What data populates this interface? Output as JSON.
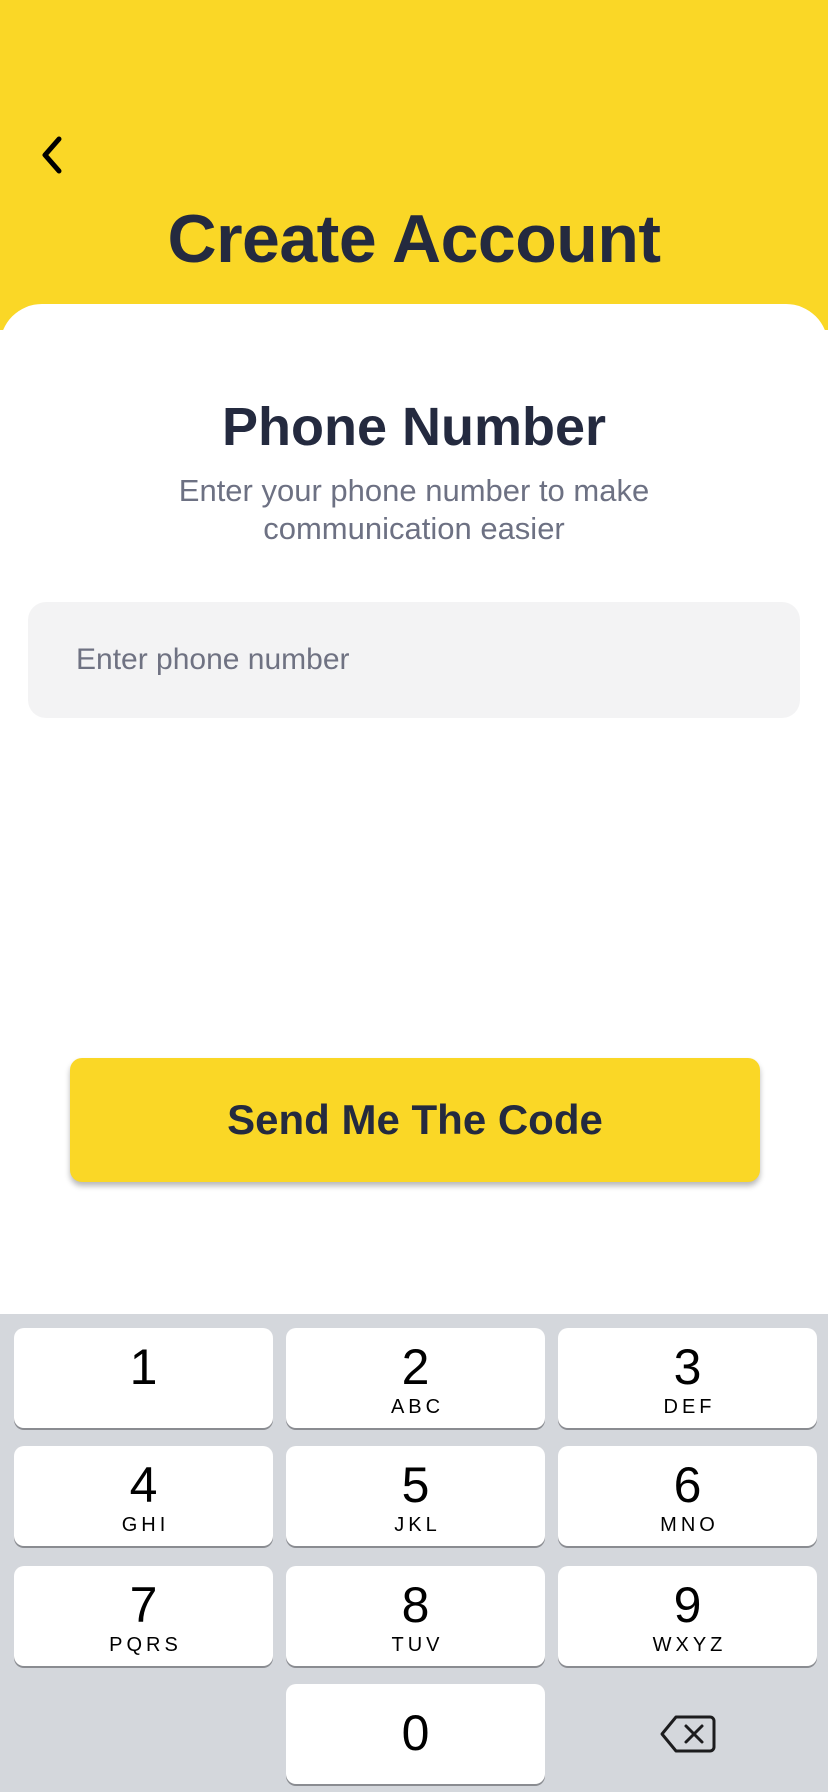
{
  "header": {
    "title": "Create Account",
    "background_color": "#FAD726"
  },
  "section": {
    "title": "Phone Number",
    "subtitle": "Enter your phone number to make communication easier"
  },
  "phone_input": {
    "placeholder": "Enter phone number",
    "value": ""
  },
  "send_button": {
    "label": "Send Me The Code"
  },
  "keypad": {
    "keys": [
      {
        "digit": "1",
        "letters": ""
      },
      {
        "digit": "2",
        "letters": "ABC"
      },
      {
        "digit": "3",
        "letters": "DEF"
      },
      {
        "digit": "4",
        "letters": "GHI"
      },
      {
        "digit": "5",
        "letters": "JKL"
      },
      {
        "digit": "6",
        "letters": "MNO"
      },
      {
        "digit": "7",
        "letters": "PQRS"
      },
      {
        "digit": "8",
        "letters": "TUV"
      },
      {
        "digit": "9",
        "letters": "WXYZ"
      },
      {
        "digit": "0",
        "letters": ""
      }
    ],
    "delete_icon": "backspace-icon"
  },
  "icons": {
    "back": "chevron-left-icon"
  },
  "colors": {
    "accent": "#FAD726",
    "text_dark": "#242A3F",
    "text_muted": "#6D7183",
    "input_bg": "#F3F3F4",
    "keypad_bg": "#D4D7DC"
  }
}
